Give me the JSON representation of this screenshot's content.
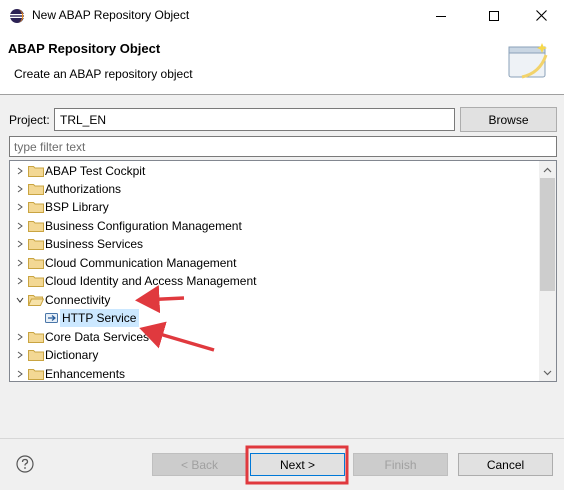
{
  "window": {
    "title": "New ABAP Repository Object"
  },
  "header": {
    "title": "ABAP Repository Object",
    "subtitle": "Create an ABAP repository object"
  },
  "project": {
    "label": "Project:",
    "value": "TRL_EN",
    "browse_label": "Browse"
  },
  "filter": {
    "placeholder": "type filter text"
  },
  "tree": {
    "items": [
      {
        "label": "ABAP Test Cockpit",
        "expanded": false
      },
      {
        "label": "Authorizations",
        "expanded": false
      },
      {
        "label": "BSP Library",
        "expanded": false
      },
      {
        "label": "Business Configuration Management",
        "expanded": false
      },
      {
        "label": "Business Services",
        "expanded": false
      },
      {
        "label": "Cloud Communication Management",
        "expanded": false
      },
      {
        "label": "Cloud Identity and Access Management",
        "expanded": false
      },
      {
        "label": "Connectivity",
        "expanded": true
      },
      {
        "label": "HTTP Service",
        "child": true,
        "selected": true
      },
      {
        "label": "Core Data Services",
        "expanded": false
      },
      {
        "label": "Dictionary",
        "expanded": false
      },
      {
        "label": "Enhancements",
        "expanded": false
      }
    ]
  },
  "footer": {
    "back_label": "< Back",
    "next_label": "Next >",
    "finish_label": "Finish",
    "cancel_label": "Cancel"
  },
  "colors": {
    "annotation_red": "#e0393e",
    "selection": "#cce8ff",
    "folder": "#dcb862"
  },
  "icons": [
    "eclipse-app-icon",
    "minimize-icon",
    "maximize-icon",
    "close-icon",
    "wizard-banner-icon",
    "folder-icon",
    "http-service-icon",
    "help-icon",
    "chevron-up-icon",
    "chevron-down-icon"
  ]
}
